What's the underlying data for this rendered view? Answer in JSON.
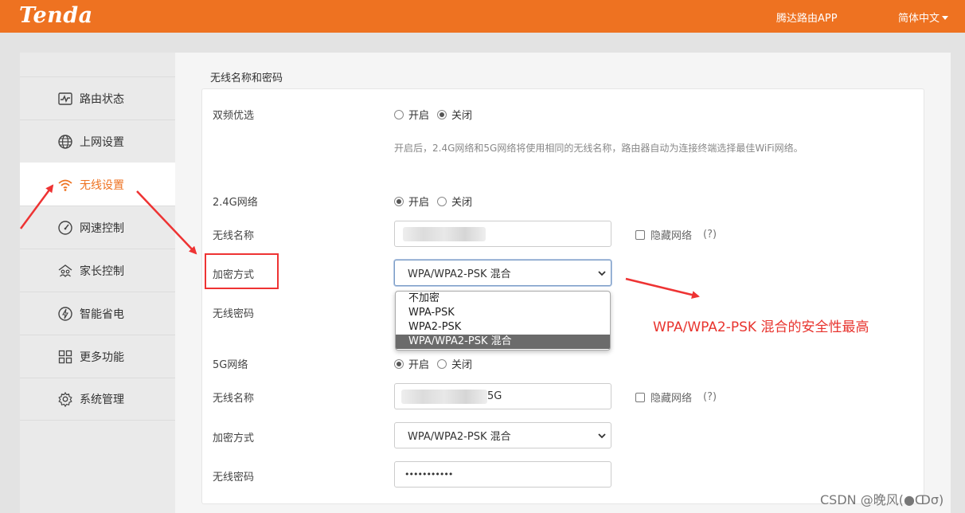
{
  "header": {
    "logo": "Tenda",
    "app_link": "腾达路由APP",
    "language": "简体中文"
  },
  "sidebar": {
    "items": [
      {
        "label": "路由状态",
        "icon": "status-chart-icon"
      },
      {
        "label": "上网设置",
        "icon": "globe-icon"
      },
      {
        "label": "无线设置",
        "icon": "wifi-icon",
        "active": true
      },
      {
        "label": "网速控制",
        "icon": "speedometer-icon"
      },
      {
        "label": "家长控制",
        "icon": "family-icon"
      },
      {
        "label": "智能省电",
        "icon": "power-save-icon"
      },
      {
        "label": "更多功能",
        "icon": "grid-icon"
      },
      {
        "label": "系统管理",
        "icon": "gear-icon"
      }
    ]
  },
  "main": {
    "section_title": "无线名称和密码",
    "dual_band": {
      "label": "双频优选",
      "options": [
        "开启",
        "关闭"
      ],
      "selected": "关闭",
      "hint": "开启后，2.4G网络和5G网络将使用相同的无线名称，路由器自动为连接终端选择最佳WiFi网络。"
    },
    "band_24": {
      "label": "2.4G网络",
      "options": [
        "开启",
        "关闭"
      ],
      "selected": "开启",
      "ssid_label": "无线名称",
      "ssid_value": "",
      "hide_label": "隐藏网络",
      "hide_help": "(?)",
      "encryption_label": "加密方式",
      "encryption_value": "WPA/WPA2-PSK 混合",
      "password_label": "无线密码",
      "dropdown_options": [
        "不加密",
        "WPA-PSK",
        "WPA2-PSK",
        "WPA/WPA2-PSK 混合"
      ],
      "dropdown_selected": "WPA/WPA2-PSK 混合"
    },
    "band_5": {
      "label": "5G网络",
      "options": [
        "开启",
        "关闭"
      ],
      "selected": "开启",
      "ssid_label": "无线名称",
      "ssid_suffix": "5G",
      "hide_label": "隐藏网络",
      "hide_help": "(?)",
      "encryption_label": "加密方式",
      "encryption_value": "WPA/WPA2-PSK 混合",
      "password_label": "无线密码",
      "password_value": "•••••••••••"
    }
  },
  "annotation": {
    "text": "WPA/WPA2-PSK 混合的安全性最高",
    "color": "#e8342e"
  },
  "watermark": "CSDN @晚风(●ↀσ)",
  "colors": {
    "brand": "#ee7221",
    "annotation_red": "#e33333"
  }
}
